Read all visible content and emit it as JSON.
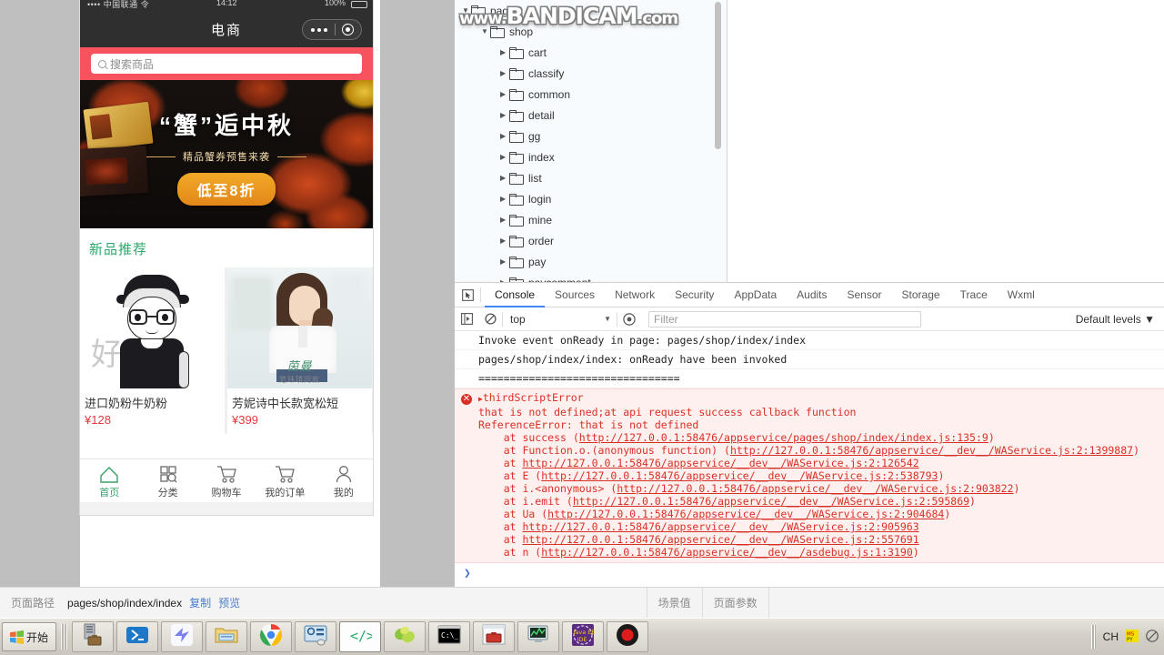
{
  "simulator": {
    "statusbar": {
      "left": "•••• 中国联通 令",
      "center": "14:12",
      "right": "100%"
    },
    "navbar": {
      "title": "电商",
      "capsule_icon": "more-and-target-icon"
    },
    "search": {
      "placeholder": "搜索商品",
      "icon": "search-icon",
      "bar_color": "#f7535f"
    },
    "banner": {
      "headline": "“蟹”逅中秋",
      "subline": "精品蟹券预售来袭",
      "badge": "低至8折"
    },
    "section": {
      "title": "新品推荐",
      "title_color": "#2aa96b"
    },
    "products": [
      {
        "name": "进口奶粉牛奶粉",
        "price": "¥128",
        "image": "line-art-boy-illustration"
      },
      {
        "name": "芳妮诗中长款宽松短",
        "price": "¥399",
        "image": "female-model-white-shirt",
        "brand": "茵曼",
        "brand_sub": "范玮琪同款"
      }
    ],
    "tabbar": [
      {
        "label": "首页",
        "icon": "home-icon",
        "active": true
      },
      {
        "label": "分类",
        "icon": "grid-search-icon",
        "active": false
      },
      {
        "label": "购物车",
        "icon": "cart-icon",
        "active": false
      },
      {
        "label": "我的订单",
        "icon": "cart-order-icon",
        "active": false
      },
      {
        "label": "我的",
        "icon": "user-icon",
        "active": false
      }
    ]
  },
  "watermark": {
    "prefix": "www.",
    "main": "BANDICAM",
    "suffix": ".com"
  },
  "file_tree": [
    {
      "label": "pages",
      "depth": 0,
      "expanded": true
    },
    {
      "label": "shop",
      "depth": 1,
      "expanded": true
    },
    {
      "label": "cart",
      "depth": 2,
      "expanded": false
    },
    {
      "label": "classify",
      "depth": 2,
      "expanded": false
    },
    {
      "label": "common",
      "depth": 2,
      "expanded": false
    },
    {
      "label": "detail",
      "depth": 2,
      "expanded": false
    },
    {
      "label": "gg",
      "depth": 2,
      "expanded": false
    },
    {
      "label": "index",
      "depth": 2,
      "expanded": false
    },
    {
      "label": "list",
      "depth": 2,
      "expanded": false
    },
    {
      "label": "login",
      "depth": 2,
      "expanded": false
    },
    {
      "label": "mine",
      "depth": 2,
      "expanded": false
    },
    {
      "label": "order",
      "depth": 2,
      "expanded": false
    },
    {
      "label": "pay",
      "depth": 2,
      "expanded": false
    },
    {
      "label": "paycomment",
      "depth": 2,
      "expanded": false
    }
  ],
  "devtools": {
    "inspect_icon": "inspect-element-icon",
    "tabs": [
      {
        "label": "Console",
        "active": true
      },
      {
        "label": "Sources",
        "active": false
      },
      {
        "label": "Network",
        "active": false
      },
      {
        "label": "Security",
        "active": false
      },
      {
        "label": "AppData",
        "active": false
      },
      {
        "label": "Audits",
        "active": false
      },
      {
        "label": "Sensor",
        "active": false
      },
      {
        "label": "Storage",
        "active": false
      },
      {
        "label": "Trace",
        "active": false
      },
      {
        "label": "Wxml",
        "active": false
      }
    ],
    "toolbar": {
      "sidebar_icon": "show-console-sidebar-icon",
      "clear_icon": "clear-console-icon",
      "context": "top",
      "eye_icon": "live-expression-icon",
      "filter_placeholder": "Filter",
      "levels": "Default levels",
      "active_tab_color": "#4285f4"
    },
    "console": {
      "logs": [
        "Invoke event onReady in page: pages/shop/index/index",
        "pages/shop/index/index: onReady have been invoked",
        "================================"
      ],
      "error": {
        "icon": "error-circle-icon",
        "title": "thirdScriptError",
        "lines": [
          "that is not defined;at api request success callback function",
          "ReferenceError: that is not defined",
          "    at success (http://127.0.0.1:58476/appservice/pages/shop/index/index.js:135:9)",
          "    at Function.o.(anonymous function) (http://127.0.0.1:58476/appservice/__dev__/WAService.js:2:1399887)",
          "    at http://127.0.0.1:58476/appservice/__dev__/WAService.js:2:126542",
          "    at E (http://127.0.0.1:58476/appservice/__dev__/WAService.js:2:538793)",
          "    at i.<anonymous> (http://127.0.0.1:58476/appservice/__dev__/WAService.js:2:903822)",
          "    at i.emit (http://127.0.0.1:58476/appservice/__dev__/WAService.js:2:595869)",
          "    at Ua (http://127.0.0.1:58476/appservice/__dev__/WAService.js:2:904684)",
          "    at http://127.0.0.1:58476/appservice/__dev__/WAService.js:2:905963",
          "    at http://127.0.0.1:58476/appservice/__dev__/WAService.js:2:557691",
          "    at n (http://127.0.0.1:58476/appservice/__dev__/asdebug.js:1:3190)"
        ]
      },
      "prompt": "❯"
    }
  },
  "statusbar": {
    "path_label": "页面路径",
    "path_value": "pages/shop/index/index",
    "copy_link": "复制",
    "preview_link": "预览",
    "scene_value": "场景值",
    "page_params": "页面参数"
  },
  "taskbar": {
    "start_label": "开始",
    "items": [
      {
        "icon": "server-toolbox-icon",
        "selected": false
      },
      {
        "icon": "powershell-icon",
        "selected": false
      },
      {
        "icon": "bird-editor-icon",
        "selected": false
      },
      {
        "icon": "file-explorer-icon",
        "selected": false
      },
      {
        "icon": "chrome-icon",
        "selected": false
      },
      {
        "icon": "control-panel-icon",
        "selected": false
      },
      {
        "icon": "code-editor-icon",
        "selected": true
      },
      {
        "icon": "navicat-icon",
        "selected": false
      },
      {
        "icon": "cmd-console-icon",
        "selected": false
      },
      {
        "icon": "toolbox-window-icon",
        "selected": false
      },
      {
        "icon": "monitor-chart-icon",
        "selected": false
      },
      {
        "icon": "java-ee-ide-icon",
        "selected": false
      },
      {
        "icon": "bandicam-record-icon",
        "selected": false
      }
    ],
    "tray": {
      "ime": "CH",
      "ime_icon": "ms-ime-icon",
      "mute_icon": "mute-icon"
    }
  }
}
